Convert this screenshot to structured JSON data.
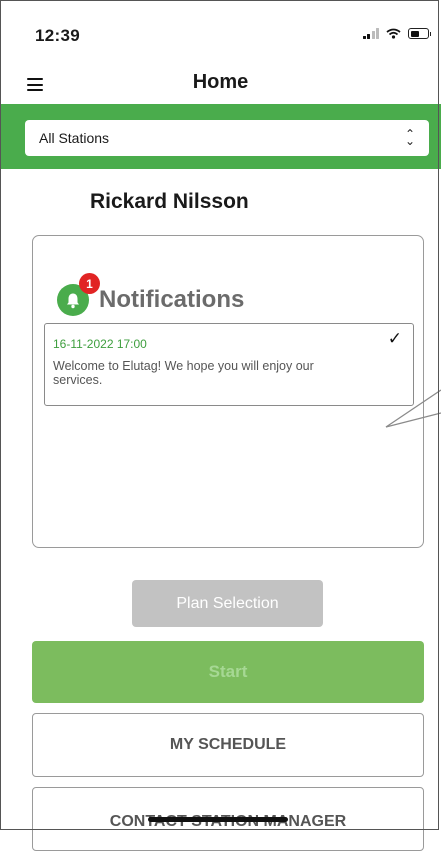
{
  "status_bar": {
    "time": "12:39"
  },
  "nav": {
    "title": "Home"
  },
  "station_select": {
    "value": "All Stations"
  },
  "user": {
    "name": "Rickard Nilsson"
  },
  "notifications": {
    "title": "Notifications",
    "badge_count": "1",
    "items": [
      {
        "date": "16-11-2022 17:00",
        "check": "✓",
        "message": "Welcome to Elutag! We hope you will enjoy our services."
      }
    ]
  },
  "buttons": {
    "plan_selection": "Plan Selection",
    "start": "Start",
    "my_schedule": "MY SCHEDULE",
    "contact_station_manager": "CONTACT STATION MANAGER"
  },
  "colors": {
    "accent": "#4aac4c",
    "badge": "#e12424",
    "start": "#7cbc5e",
    "date": "#3e9e3e"
  }
}
